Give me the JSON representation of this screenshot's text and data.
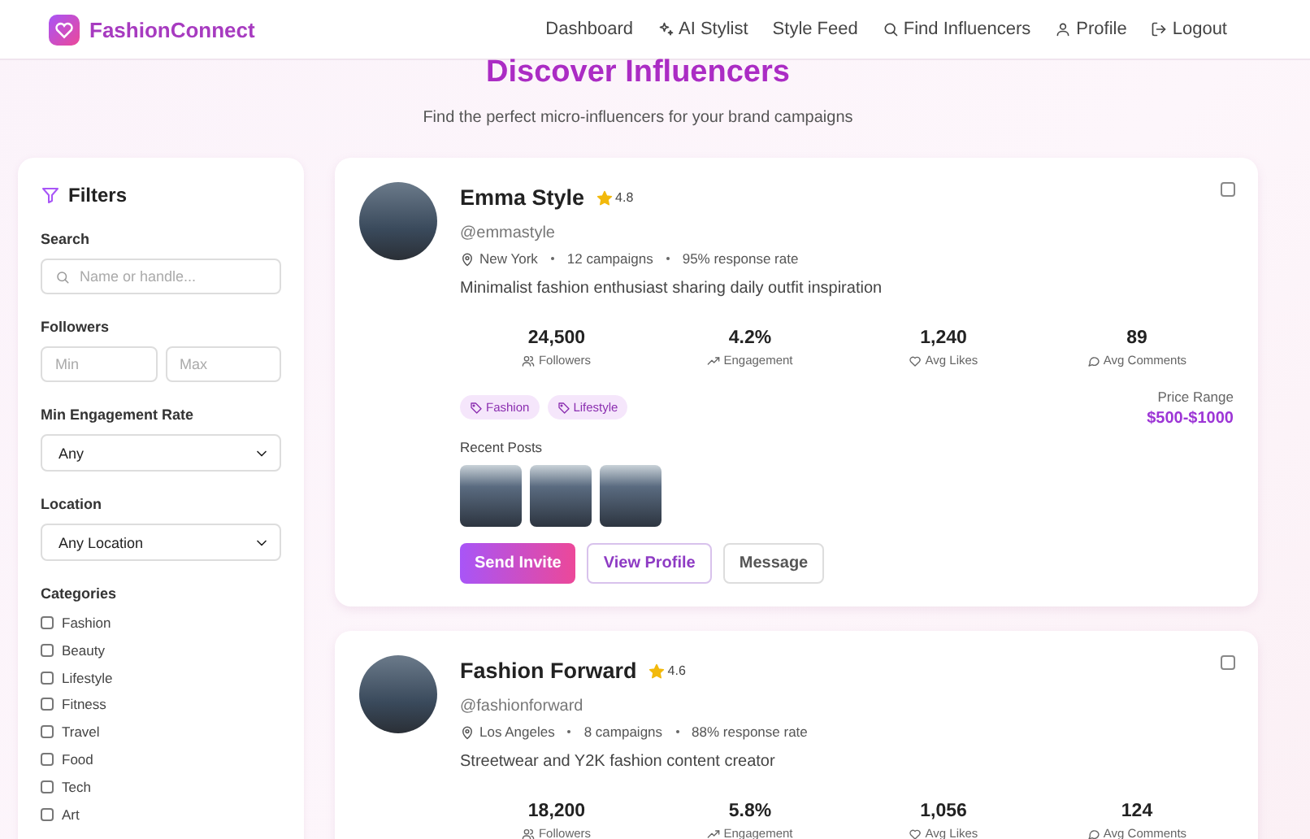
{
  "header": {
    "logo_text": "FashionConnect",
    "nav": [
      {
        "label": "Dashboard"
      },
      {
        "label": "AI Stylist"
      },
      {
        "label": "Style Feed"
      },
      {
        "label": "Find Influencers"
      },
      {
        "label": "Profile"
      },
      {
        "label": "Logout"
      }
    ]
  },
  "page": {
    "title": "Discover Influencers",
    "subtitle": "Find the perfect micro-influencers for your brand campaigns"
  },
  "filters": {
    "title": "Filters",
    "search": {
      "label": "Search",
      "placeholder": "Name or handle..."
    },
    "followers": {
      "label": "Followers",
      "min_placeholder": "Min",
      "max_placeholder": "Max"
    },
    "engagement": {
      "label": "Min Engagement Rate",
      "value": "Any"
    },
    "location": {
      "label": "Location",
      "value": "Any Location"
    },
    "categories": {
      "label": "Categories",
      "items": [
        {
          "label": "Fashion",
          "checked": false
        },
        {
          "label": "Beauty",
          "checked": false
        },
        {
          "label": "Lifestyle",
          "checked": false
        },
        {
          "label": "Fitness",
          "checked": false
        },
        {
          "label": "Travel",
          "checked": false
        },
        {
          "label": "Food",
          "checked": false
        },
        {
          "label": "Tech",
          "checked": false
        },
        {
          "label": "Art",
          "checked": false
        }
      ]
    }
  },
  "influencers": [
    {
      "name": "Emma Style",
      "rating": "4.8",
      "handle": "@emmastyle",
      "location": "New York",
      "campaigns": "12 campaigns",
      "response": "95% response rate",
      "bio": "Minimalist fashion enthusiast sharing daily outfit inspiration",
      "checked": false,
      "stats": [
        {
          "value": "24,500",
          "label": "Followers"
        },
        {
          "value": "4.2%",
          "label": "Engagement"
        },
        {
          "value": "1,240",
          "label": "Avg Likes"
        },
        {
          "value": "89",
          "label": "Avg Comments"
        }
      ],
      "tags": [
        "Fashion",
        "Lifestyle"
      ],
      "price_label": "Price Range",
      "price": "$500-$1000",
      "posts_label": "Recent Posts",
      "posts": [
        {
          "kind": "photo"
        },
        {
          "kind": "photo"
        },
        {
          "kind": "photo"
        }
      ],
      "buttons": [
        {
          "label": "Send Invite",
          "kind": "primary"
        },
        {
          "label": "View Profile",
          "kind": "outline"
        },
        {
          "label": "Message",
          "kind": "plain"
        }
      ]
    },
    {
      "name": "Fashion Forward",
      "rating": "4.6",
      "handle": "@fashionforward",
      "location": "Los Angeles",
      "campaigns": "8 campaigns",
      "response": "88% response rate",
      "bio": "Streetwear and Y2K fashion content creator",
      "checked": false,
      "stats": [
        {
          "value": "18,200",
          "label": "Followers"
        },
        {
          "value": "5.8%",
          "label": "Engagement"
        },
        {
          "value": "1,056",
          "label": "Avg Likes"
        },
        {
          "value": "124",
          "label": "Avg Comments"
        }
      ]
    }
  ]
}
